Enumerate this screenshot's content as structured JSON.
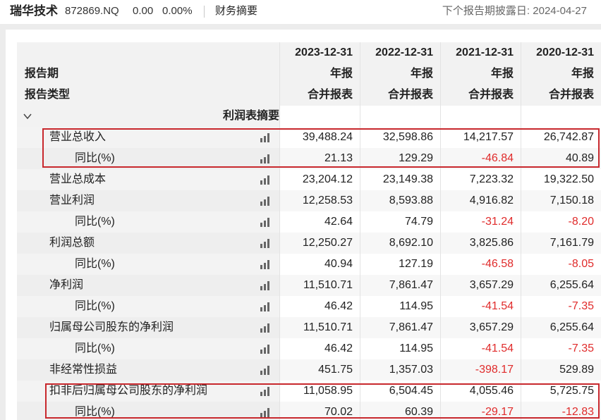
{
  "header": {
    "company_name": "瑞华技术",
    "stock_code": "872869.NQ",
    "price": "0.00",
    "change_pct": "0.00%",
    "tab_label": "财务摘要",
    "next_report": "下个报告期披露日: 2024-04-27"
  },
  "table": {
    "report_period_label": "报告期",
    "report_type_label": "报告类型",
    "periods": [
      {
        "date": "2023-12-31",
        "report_period": "年报",
        "report_type": "合并报表"
      },
      {
        "date": "2022-12-31",
        "report_period": "年报",
        "report_type": "合并报表"
      },
      {
        "date": "2021-12-31",
        "report_period": "年报",
        "report_type": "合并报表"
      },
      {
        "date": "2020-12-31",
        "report_period": "年报",
        "report_type": "合并报表"
      }
    ],
    "section": {
      "label": "利润表摘要",
      "expanded": true
    },
    "rows": [
      {
        "label": "营业总收入",
        "values": [
          "39,488.24",
          "32,598.86",
          "14,217.57",
          "26,742.87"
        ]
      },
      {
        "label": "同比(%)",
        "values": [
          "21.13",
          "129.29",
          "-46.84",
          "40.89"
        ]
      },
      {
        "label": "营业总成本",
        "values": [
          "23,204.12",
          "23,149.38",
          "7,223.32",
          "19,322.50"
        ]
      },
      {
        "label": "营业利润",
        "values": [
          "12,258.53",
          "8,593.88",
          "4,916.82",
          "7,150.18"
        ]
      },
      {
        "label": "同比(%)",
        "values": [
          "42.64",
          "74.79",
          "-31.24",
          "-8.20"
        ]
      },
      {
        "label": "利润总额",
        "values": [
          "12,250.27",
          "8,692.10",
          "3,825.86",
          "7,161.79"
        ]
      },
      {
        "label": "同比(%)",
        "values": [
          "40.94",
          "127.19",
          "-46.58",
          "-8.05"
        ]
      },
      {
        "label": "净利润",
        "values": [
          "11,510.71",
          "7,861.47",
          "3,657.29",
          "6,255.64"
        ]
      },
      {
        "label": "同比(%)",
        "values": [
          "46.42",
          "114.95",
          "-41.54",
          "-7.35"
        ]
      },
      {
        "label": "归属母公司股东的净利润",
        "values": [
          "11,510.71",
          "7,861.47",
          "3,657.29",
          "6,255.64"
        ]
      },
      {
        "label": "同比(%)",
        "values": [
          "46.42",
          "114.95",
          "-41.54",
          "-7.35"
        ]
      },
      {
        "label": "非经常性损益",
        "values": [
          "451.75",
          "1,357.03",
          "-398.17",
          "529.89"
        ]
      },
      {
        "label": "扣非后归属母公司股东的净利润",
        "values": [
          "11,058.95",
          "6,504.45",
          "4,055.46",
          "5,725.75"
        ]
      },
      {
        "label": "同比(%)",
        "values": [
          "70.02",
          "60.39",
          "-29.17",
          "-12.83"
        ]
      }
    ]
  },
  "icons": {
    "row_chart": "bar-chart-icon",
    "section_toggle": "chevron-down-icon"
  },
  "colors": {
    "text": "#222222",
    "negative_value": "#e02b2b",
    "highlight_box": "#c8282d",
    "header_bg": "#f2f2f2"
  }
}
